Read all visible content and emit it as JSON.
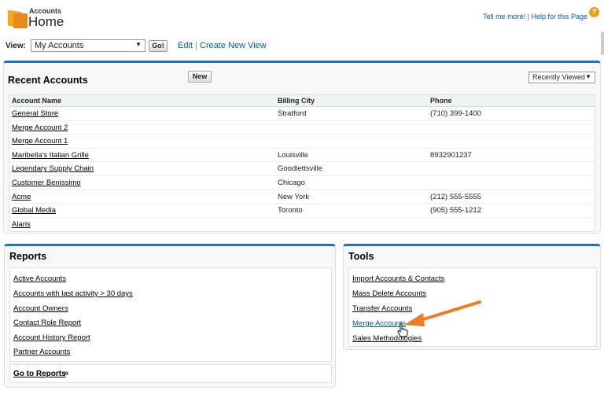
{
  "header": {
    "breadcrumb": "Accounts",
    "title": "Home",
    "help_text": "Tell me more!",
    "help_page_text": "Help for this Page",
    "help_sep": "|"
  },
  "viewbar": {
    "label": "View:",
    "selected_view": "My Accounts",
    "go_label": "Go!",
    "edit_label": "Edit",
    "create_label": "Create New View",
    "pipe": "|"
  },
  "recent": {
    "title": "Recent Accounts",
    "new_label": "New",
    "sort_selected": "Recently Viewed",
    "columns": [
      "Account Name",
      "Billing City",
      "Phone"
    ],
    "rows": [
      {
        "name": "General Store",
        "city": "Stratford",
        "phone": "(710) 399-1400"
      },
      {
        "name": "Merge Account 2",
        "city": "",
        "phone": ""
      },
      {
        "name": "Merge Account 1",
        "city": "",
        "phone": ""
      },
      {
        "name": "Maribella's Italian Grille",
        "city": "Louisville",
        "phone": "8932901237"
      },
      {
        "name": "Legendary Supply Chain",
        "city": "Goodlettsville",
        "phone": ""
      },
      {
        "name": "Customer Benissimo",
        "city": "Chicago",
        "phone": ""
      },
      {
        "name": "Acme",
        "city": "New York",
        "phone": "(212) 555-5555"
      },
      {
        "name": "Global Media",
        "city": "Toronto",
        "phone": "(905) 555-1212"
      },
      {
        "name": "Alaris",
        "city": "",
        "phone": ""
      }
    ]
  },
  "reports": {
    "title": "Reports",
    "items": [
      "Active Accounts",
      "Accounts with last activity > 30 days",
      "Account Owners",
      "Contact Role Report",
      "Account History Report",
      "Partner Accounts"
    ],
    "go_label": "Go to Reports",
    "go_suffix": "»"
  },
  "tools": {
    "title": "Tools",
    "items": [
      "Import Accounts & Contacts",
      "Mass Delete Accounts",
      "Transfer Accounts",
      "Merge Accounts",
      "Sales Methodologies"
    ]
  },
  "icons": {
    "accounts": "accounts-icon",
    "help": "help-icon",
    "dropdown": "chevron-down-icon",
    "annotation": "orange-arrow-icon",
    "cursor": "hand-cursor-icon"
  },
  "colors": {
    "accent": "#236fbd",
    "link": "#015ba7",
    "arrow": "#f07c21",
    "icon": "#e88a1a"
  }
}
